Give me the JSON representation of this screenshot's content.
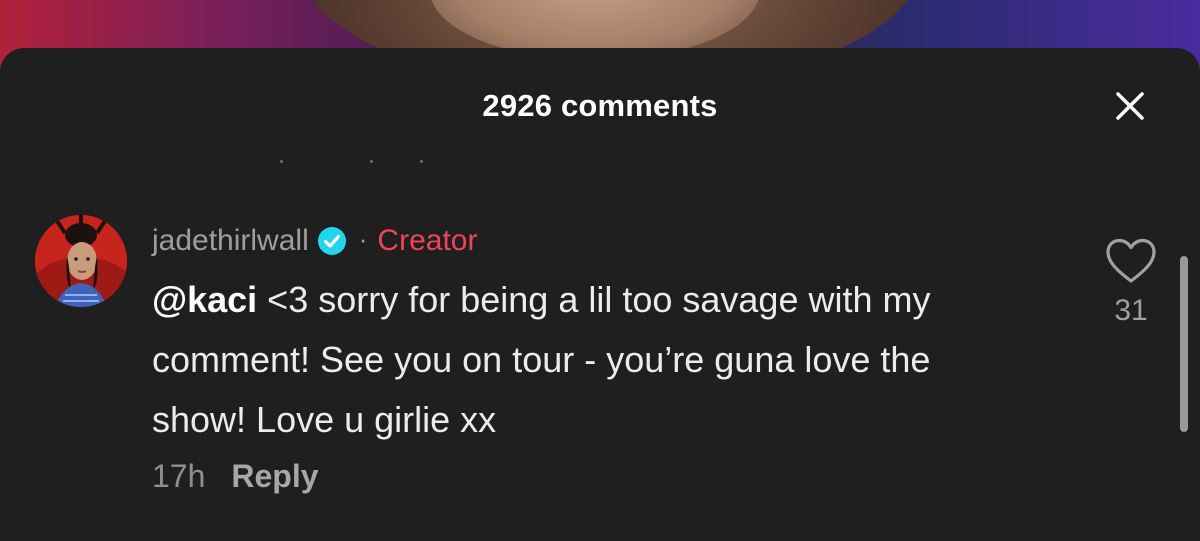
{
  "header": {
    "title": "2926 comments",
    "close_icon": "close-icon"
  },
  "comment": {
    "username": "jadethirlwall",
    "verified_icon": "verified-badge-icon",
    "separator": "·",
    "role_label": "Creator",
    "mention": "@kaci",
    "text": " <3 sorry for being a lil too savage with my comment! See you on tour - you’re guna love the show! Love u girlie xx",
    "time": "17h",
    "reply_label": "Reply",
    "like_icon": "heart-outline-icon",
    "like_count": "31"
  },
  "colors": {
    "background": "#1f1f1f",
    "creator_accent": "#f1425c",
    "verified_badge": "#20d5ec",
    "text_primary": "#ececec",
    "text_secondary": "#9e9e9e"
  }
}
